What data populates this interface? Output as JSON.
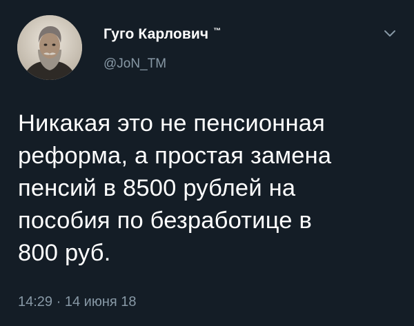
{
  "tweet": {
    "author": {
      "display_name": "Гуго Карлович",
      "trademark": "™",
      "handle": "@JoN_TM",
      "avatar_icon": "portrait-avatar"
    },
    "menu_icon": "chevron-down-icon",
    "text_lines": [
      "Никакая это не пенсионная",
      "реформа, а простая замена",
      "пенсий в 8500 рублей на",
      "пособия по безработице в",
      "800 руб."
    ],
    "time": "14:29",
    "separator": "·",
    "date": "14 июня 18",
    "colors": {
      "background": "#141d26",
      "primary_text": "#ffffff",
      "secondary_text": "#8899a6"
    }
  }
}
